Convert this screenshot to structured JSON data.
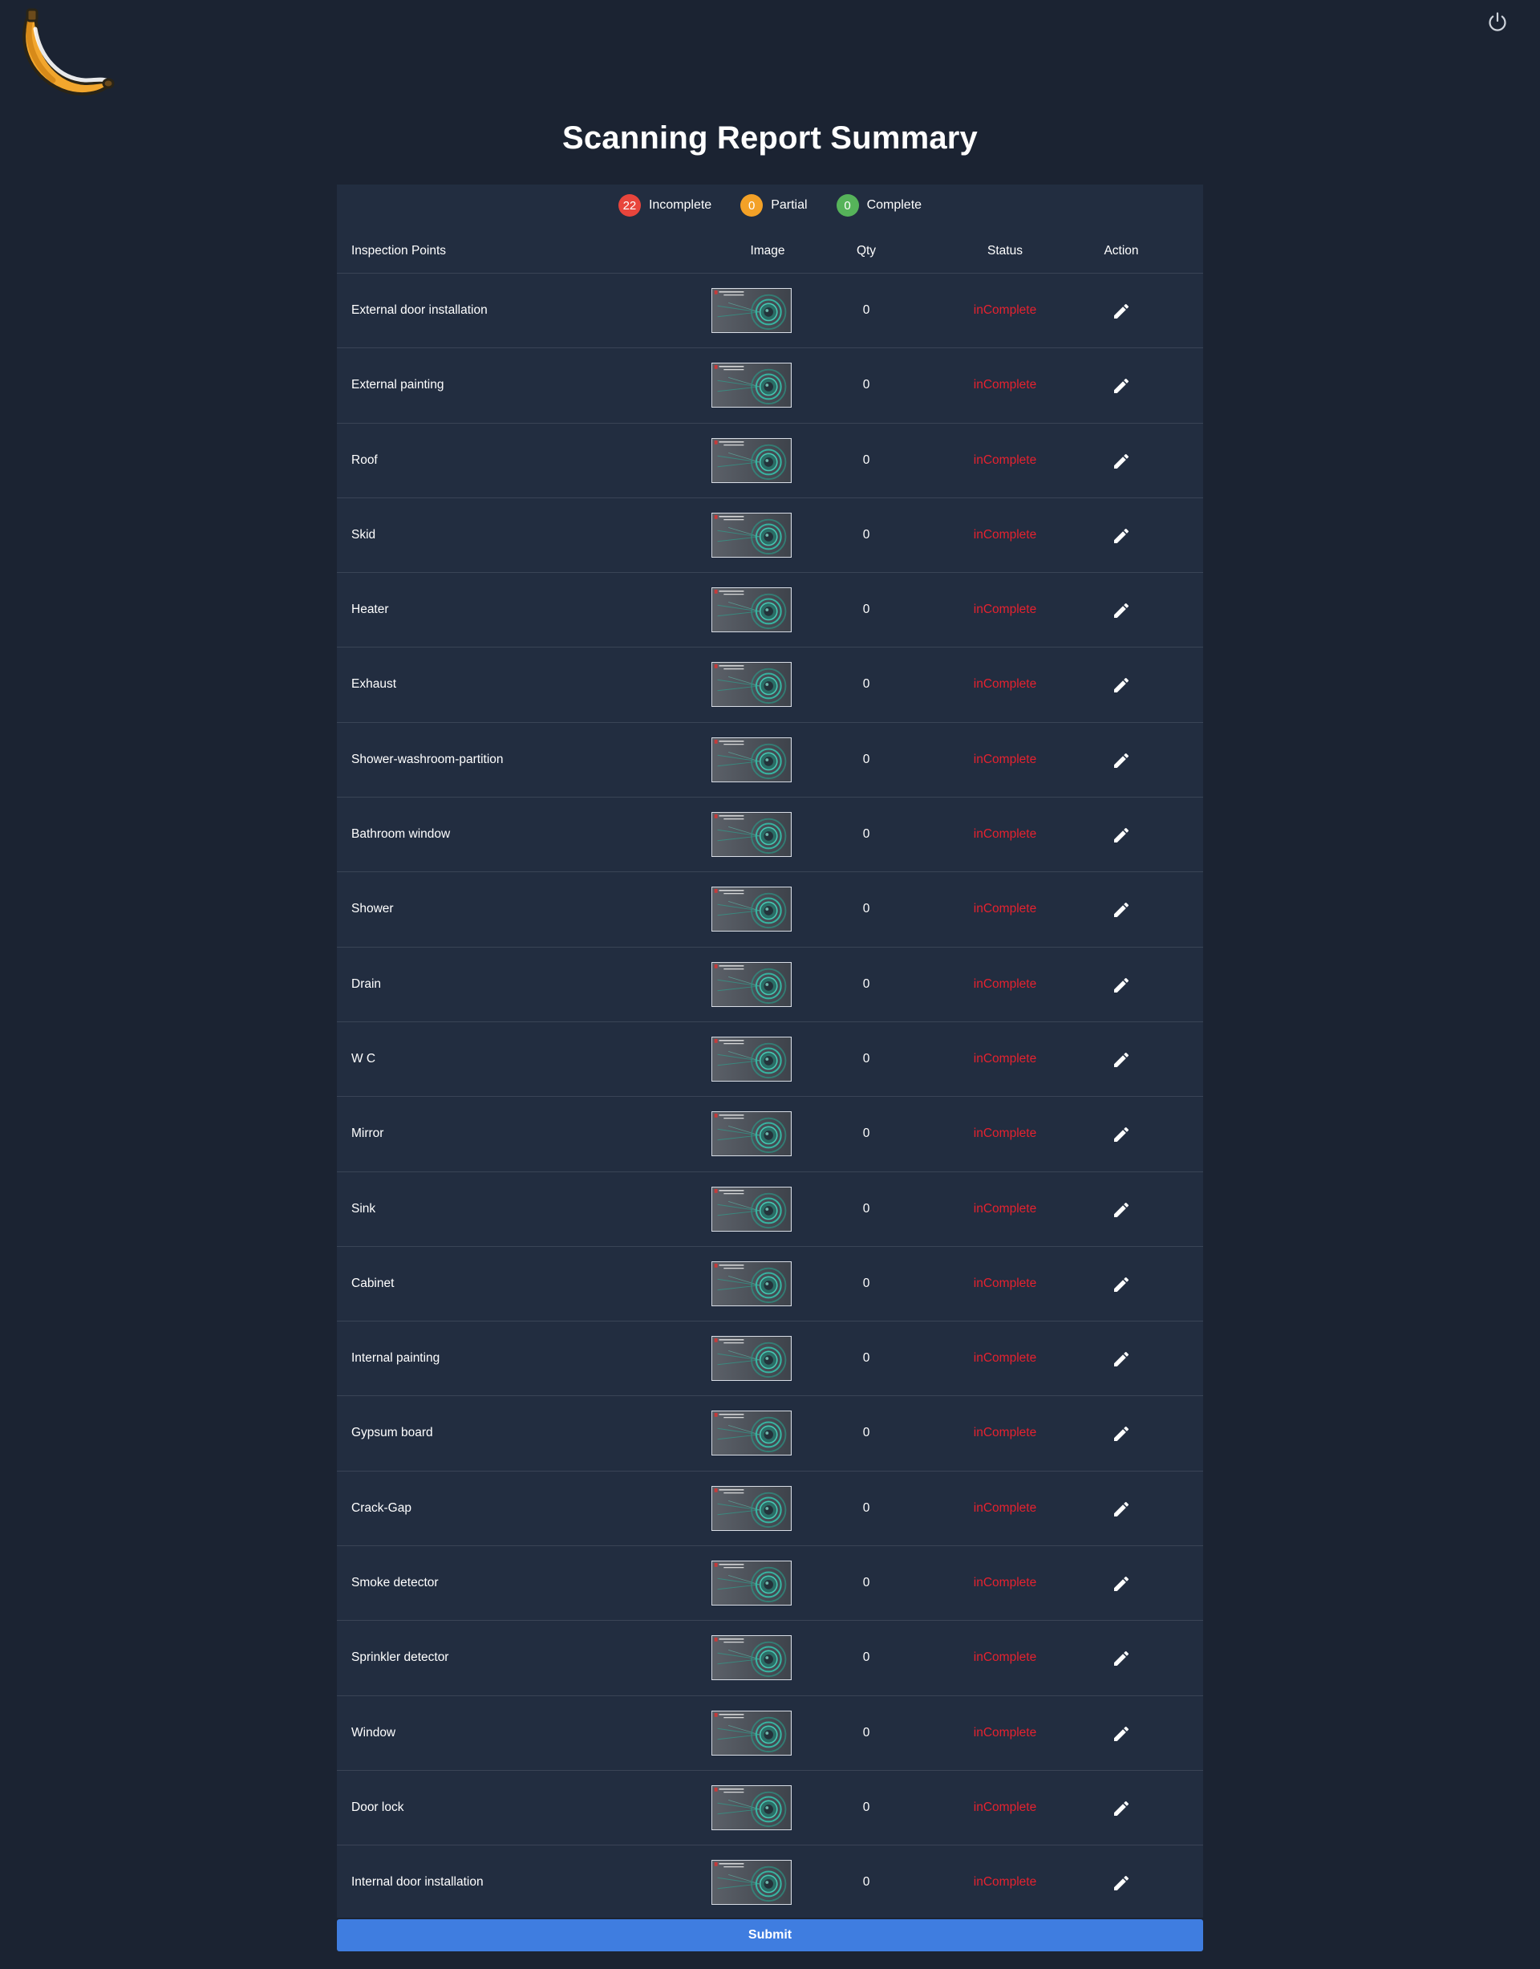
{
  "header": {
    "logo_icon": "banana-logo-icon",
    "power_icon": "power-icon"
  },
  "title": "Scanning Report Summary",
  "legend": [
    {
      "count": "22",
      "label": "Incomplete",
      "color": "#e8453c"
    },
    {
      "count": "0",
      "label": "Partial",
      "color": "#f3a127"
    },
    {
      "count": "0",
      "label": "Complete",
      "color": "#56b35a"
    }
  ],
  "table": {
    "columns": {
      "name": "Inspection Points",
      "image": "Image",
      "qty": "Qty",
      "status": "Status",
      "action": "Action"
    },
    "rows": [
      {
        "name": "External door installation",
        "qty": "0",
        "status": "inComplete"
      },
      {
        "name": "External painting",
        "qty": "0",
        "status": "inComplete"
      },
      {
        "name": "Roof",
        "qty": "0",
        "status": "inComplete"
      },
      {
        "name": "Skid",
        "qty": "0",
        "status": "inComplete"
      },
      {
        "name": "Heater",
        "qty": "0",
        "status": "inComplete"
      },
      {
        "name": "Exhaust",
        "qty": "0",
        "status": "inComplete"
      },
      {
        "name": "Shower-washroom-partition",
        "qty": "0",
        "status": "inComplete"
      },
      {
        "name": "Bathroom window",
        "qty": "0",
        "status": "inComplete"
      },
      {
        "name": "Shower",
        "qty": "0",
        "status": "inComplete"
      },
      {
        "name": "Drain",
        "qty": "0",
        "status": "inComplete"
      },
      {
        "name": "W C",
        "qty": "0",
        "status": "inComplete"
      },
      {
        "name": "Mirror",
        "qty": "0",
        "status": "inComplete"
      },
      {
        "name": "Sink",
        "qty": "0",
        "status": "inComplete"
      },
      {
        "name": "Cabinet",
        "qty": "0",
        "status": "inComplete"
      },
      {
        "name": "Internal painting",
        "qty": "0",
        "status": "inComplete"
      },
      {
        "name": "Gypsum board",
        "qty": "0",
        "status": "inComplete"
      },
      {
        "name": "Crack-Gap",
        "qty": "0",
        "status": "inComplete"
      },
      {
        "name": "Smoke detector",
        "qty": "0",
        "status": "inComplete"
      },
      {
        "name": "Sprinkler detector",
        "qty": "0",
        "status": "inComplete"
      },
      {
        "name": "Window",
        "qty": "0",
        "status": "inComplete"
      },
      {
        "name": "Door lock",
        "qty": "0",
        "status": "inComplete"
      },
      {
        "name": "Internal door installation",
        "qty": "0",
        "status": "inComplete"
      }
    ],
    "row_image_icon": "scan-placeholder-thumbnail",
    "row_action_icon": "pencil-edit-icon",
    "status_color": "#e5222f"
  },
  "submit_label": "Submit",
  "colors": {
    "background": "#1b2332",
    "panel": "#222d40",
    "accent": "#3f7de0"
  }
}
